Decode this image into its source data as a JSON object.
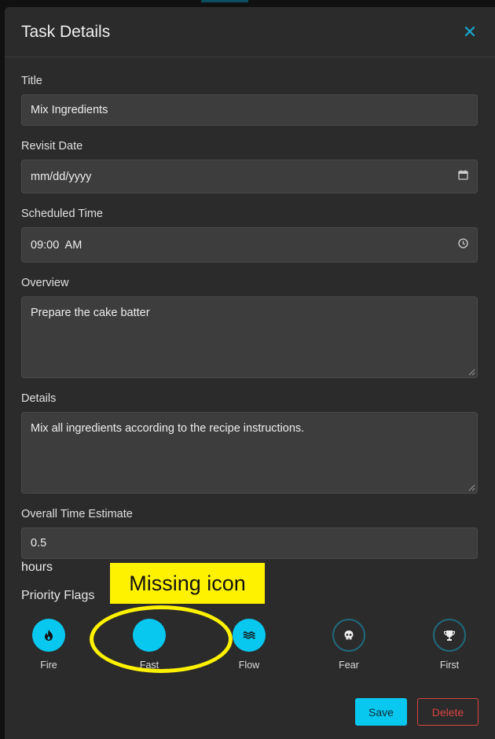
{
  "modal": {
    "title": "Task Details",
    "close_glyph": "✕"
  },
  "fields": {
    "title": {
      "label": "Title",
      "value": "Mix Ingredients"
    },
    "revisit_date": {
      "label": "Revisit Date",
      "value": "mm/dd/yyyy",
      "icon": "calendar-icon"
    },
    "scheduled_time": {
      "label": "Scheduled Time",
      "value": "09:00  AM",
      "icon": "clock-icon"
    },
    "overview": {
      "label": "Overview",
      "value": "Prepare the cake batter"
    },
    "details": {
      "label": "Details",
      "value": "Mix all ingredients according to the recipe instructions."
    },
    "time_estimate": {
      "label": "Overall Time Estimate",
      "value": "0.5",
      "unit": "hours"
    }
  },
  "priority_flags": {
    "title": "Priority Flags",
    "items": [
      {
        "label": "Fire",
        "icon": "fire-icon",
        "active": true
      },
      {
        "label": "Fast",
        "icon": "none",
        "active": true
      },
      {
        "label": "Flow",
        "icon": "waves-icon",
        "active": true
      },
      {
        "label": "Fear",
        "icon": "skull-icon",
        "active": false
      },
      {
        "label": "First",
        "icon": "trophy-icon",
        "active": false
      }
    ]
  },
  "footer": {
    "save_label": "Save",
    "delete_label": "Delete"
  },
  "annotation": {
    "text": "Missing icon"
  },
  "colors": {
    "accent": "#08c8f0",
    "danger": "#d8443f",
    "annotation": "#fff200",
    "modal_bg": "#2b2b2b",
    "input_bg": "#3d3d3d"
  }
}
